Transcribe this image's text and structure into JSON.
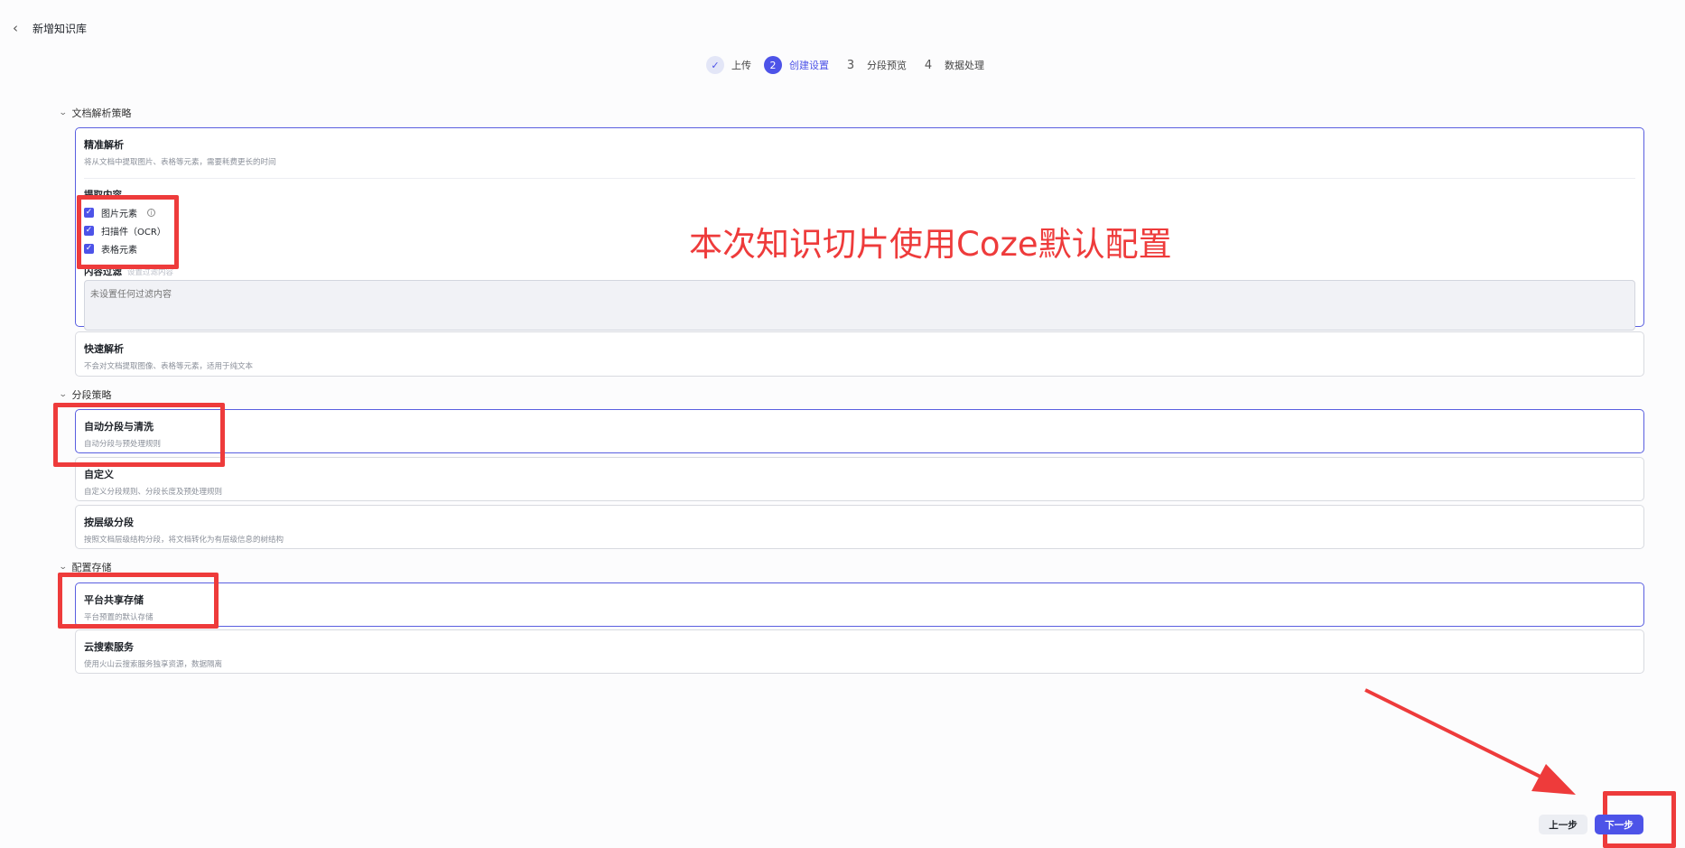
{
  "header": {
    "back_icon": "chevron-left-icon",
    "title": "新增知识库"
  },
  "stepper": {
    "steps": [
      {
        "number": "✓",
        "label": "上传",
        "state": "done"
      },
      {
        "number": "2",
        "label": "创建设置",
        "state": "active"
      },
      {
        "number": "3",
        "label": "分段预览",
        "state": "todo"
      },
      {
        "number": "4",
        "label": "数据处理",
        "state": "todo"
      }
    ]
  },
  "parse_strategy": {
    "heading": "文档解析策略",
    "precise": {
      "title": "精准解析",
      "desc": "将从文档中提取图片、表格等元素，需要耗费更长的时间",
      "extract_title": "提取内容",
      "options": [
        "图片元素",
        "扫描件（OCR）",
        "表格元素"
      ],
      "filter_title": "内容过滤",
      "filter_setting": "设置过滤内容",
      "filter_placeholder": "未设置任何过滤内容"
    },
    "fast": {
      "title": "快速解析",
      "desc": "不会对文档提取图像、表格等元素，适用于纯文本"
    }
  },
  "segment_strategy": {
    "heading": "分段策略",
    "auto": {
      "title": "自动分段与清洗",
      "desc": "自动分段与预处理规则"
    },
    "custom": {
      "title": "自定义",
      "desc": "自定义分段规则、分段长度及预处理规则"
    },
    "hierarchy": {
      "title": "按层级分段",
      "desc": "按照文档层级结构分段，将文档转化为有层级信息的树结构"
    }
  },
  "storage": {
    "heading": "配置存储",
    "platform": {
      "title": "平台共享存储",
      "desc": "平台预置的默认存储"
    },
    "cloud": {
      "title": "云搜索服务",
      "desc": "使用火山云搜索服务独享资源，数据隔离"
    }
  },
  "annotation": {
    "text": "本次知识切片使用Coze默认配置",
    "color": "#ee3b3b"
  },
  "buttons": {
    "prev": "上一步",
    "next": "下一步"
  },
  "colors": {
    "accent": "#4d53e8",
    "annotation_red": "#ee3b3b"
  }
}
